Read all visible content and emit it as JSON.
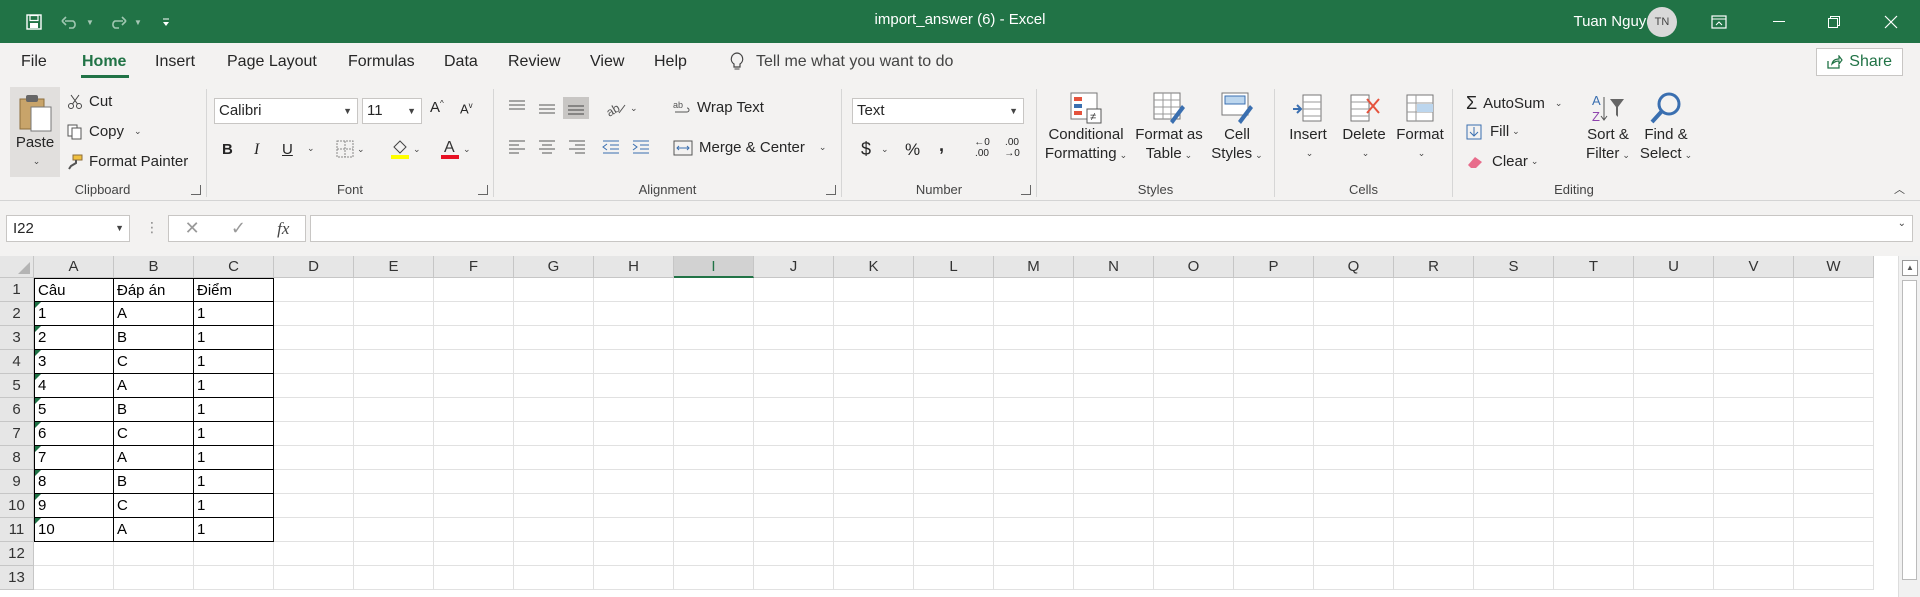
{
  "titlebar": {
    "title": "import_answer (6)  -  Excel",
    "user_name": "Tuan Nguyen",
    "avatar_initials": "TN",
    "brand_color": "#217346",
    "quick_access": [
      "save-icon",
      "undo-icon",
      "redo-icon",
      "customize-icon"
    ],
    "window_buttons": [
      "ribbon-display-icon",
      "minimize-icon",
      "restore-icon",
      "close-icon"
    ]
  },
  "menu": {
    "tabs": [
      "File",
      "Home",
      "Insert",
      "Page Layout",
      "Formulas",
      "Data",
      "Review",
      "View",
      "Help"
    ],
    "active_tab": "Home",
    "tell_me": "Tell me what you want to do",
    "share": "Share"
  },
  "ribbon": {
    "clipboard": {
      "label": "Clipboard",
      "paste": "Paste",
      "cut": "Cut",
      "copy": "Copy",
      "format_painter": "Format Painter"
    },
    "font": {
      "label": "Font",
      "font_name": "Calibri",
      "font_size": "11",
      "bold": "B",
      "italic": "I",
      "underline": "U"
    },
    "alignment": {
      "label": "Alignment",
      "wrap_text": "Wrap Text",
      "merge_center": "Merge & Center"
    },
    "number": {
      "label": "Number",
      "format": "Text",
      "currency": "$",
      "percent": "%",
      "comma": ",",
      "inc_decimal": "←0 .00",
      "dec_decimal": ".00 →0"
    },
    "styles": {
      "label": "Styles",
      "conditional_formatting": [
        "Conditional",
        "Formatting"
      ],
      "format_as_table": [
        "Format as",
        "Table"
      ],
      "cell_styles": [
        "Cell",
        "Styles"
      ]
    },
    "cells": {
      "label": "Cells",
      "insert": "Insert",
      "delete": "Delete",
      "format": "Format"
    },
    "editing": {
      "label": "Editing",
      "autosum": "AutoSum",
      "fill": "Fill",
      "clear": "Clear",
      "sort_filter": [
        "Sort &",
        "Filter"
      ],
      "find_select": [
        "Find &",
        "Select"
      ]
    }
  },
  "formula_bar": {
    "name_box": "I22",
    "fx": "fx",
    "value": ""
  },
  "sheet": {
    "columns": [
      "A",
      "B",
      "C",
      "D",
      "E",
      "F",
      "G",
      "H",
      "I",
      "J",
      "K",
      "L",
      "M",
      "N",
      "O",
      "P",
      "Q",
      "R",
      "S",
      "T",
      "U",
      "V",
      "W"
    ],
    "selected_column": "I",
    "rows": [
      "1",
      "2",
      "3",
      "4",
      "5",
      "6",
      "7",
      "8",
      "9",
      "10",
      "11",
      "12",
      "13"
    ],
    "data": [
      [
        "Câu",
        "Đáp án",
        "Điểm"
      ],
      [
        "1",
        "A",
        "1"
      ],
      [
        "2",
        "B",
        "1"
      ],
      [
        "3",
        "C",
        "1"
      ],
      [
        "4",
        "A",
        "1"
      ],
      [
        "5",
        "B",
        "1"
      ],
      [
        "6",
        "C",
        "1"
      ],
      [
        "7",
        "A",
        "1"
      ],
      [
        "8",
        "B",
        "1"
      ],
      [
        "9",
        "C",
        "1"
      ],
      [
        "10",
        "A",
        "1"
      ]
    ]
  }
}
